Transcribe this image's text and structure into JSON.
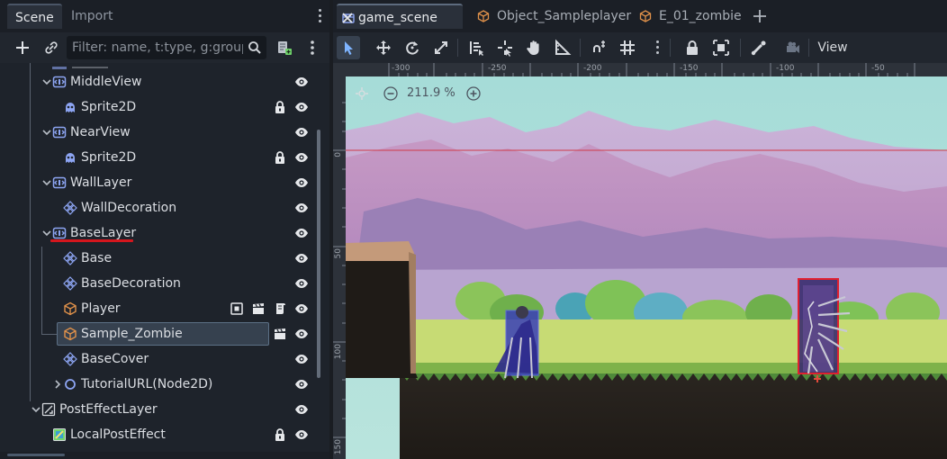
{
  "dock": {
    "tabs": {
      "scene": "Scene",
      "import": "Import"
    },
    "filter": {
      "placeholder": "Filter: name, t:type, g:group"
    },
    "tree": [
      {
        "label": "MiddleView",
        "type": "parallax",
        "depth": 1,
        "expanded": true,
        "trailing": [
          "eye"
        ]
      },
      {
        "label": "Sprite2D",
        "type": "sprite",
        "depth": 2,
        "trailing": [
          "lock",
          "eye"
        ]
      },
      {
        "label": "NearView",
        "type": "parallax",
        "depth": 1,
        "expanded": true,
        "trailing": [
          "eye"
        ]
      },
      {
        "label": "Sprite2D",
        "type": "sprite",
        "depth": 2,
        "trailing": [
          "lock",
          "eye"
        ]
      },
      {
        "label": "WallLayer",
        "type": "parallax",
        "depth": 1,
        "expanded": true,
        "trailing": [
          "eye"
        ]
      },
      {
        "label": "WallDecoration",
        "type": "tilemap",
        "depth": 2,
        "trailing": [
          "eye"
        ]
      },
      {
        "label": "BaseLayer",
        "type": "parallax",
        "depth": 1,
        "expanded": true,
        "trailing": [
          "eye"
        ]
      },
      {
        "label": "Base",
        "type": "tilemap",
        "depth": 2,
        "trailing": [
          "eye"
        ]
      },
      {
        "label": "BaseDecoration",
        "type": "tilemap",
        "depth": 2,
        "trailing": [
          "eye"
        ]
      },
      {
        "label": "Player",
        "type": "scene",
        "depth": 2,
        "trailing": [
          "group",
          "clapper",
          "script",
          "eye"
        ]
      },
      {
        "label": "Sample_Zombie",
        "type": "scene",
        "depth": 2,
        "selected": true,
        "trailing": [
          "clapper",
          "eye"
        ]
      },
      {
        "label": "BaseCover",
        "type": "tilemap",
        "depth": 2,
        "trailing": [
          "eye"
        ]
      },
      {
        "label": "TutorialURL(Node2D)",
        "type": "node2d",
        "depth": 2,
        "collapsed": true,
        "trailing": [
          "eye"
        ]
      },
      {
        "label": "PostEffectLayer",
        "type": "canvaslayer",
        "depth": 0,
        "expanded": true,
        "trailing": [
          "eye"
        ]
      },
      {
        "label": "LocalPostEffect",
        "type": "colorrect",
        "depth": 1,
        "trailing": [
          "lock",
          "eye"
        ]
      }
    ]
  },
  "editor": {
    "tabs": [
      {
        "label": "game_scene",
        "active": true
      },
      {
        "label": "Object_Sampleplayer",
        "active": false
      },
      {
        "label": "E_01_zombie",
        "active": false
      }
    ],
    "view_menu": "View",
    "zoom": "211.9 %",
    "ruler_top": [
      "-300",
      "-250",
      "-200",
      "-150",
      "-100",
      "-50"
    ],
    "ruler_left": [
      "0",
      "50",
      "100",
      "150"
    ]
  },
  "colors": {
    "accent_red": "#d4161d",
    "node2d_blue": "#8da5f3",
    "scene_orange": "#e0914a",
    "selection": "#36414f"
  }
}
